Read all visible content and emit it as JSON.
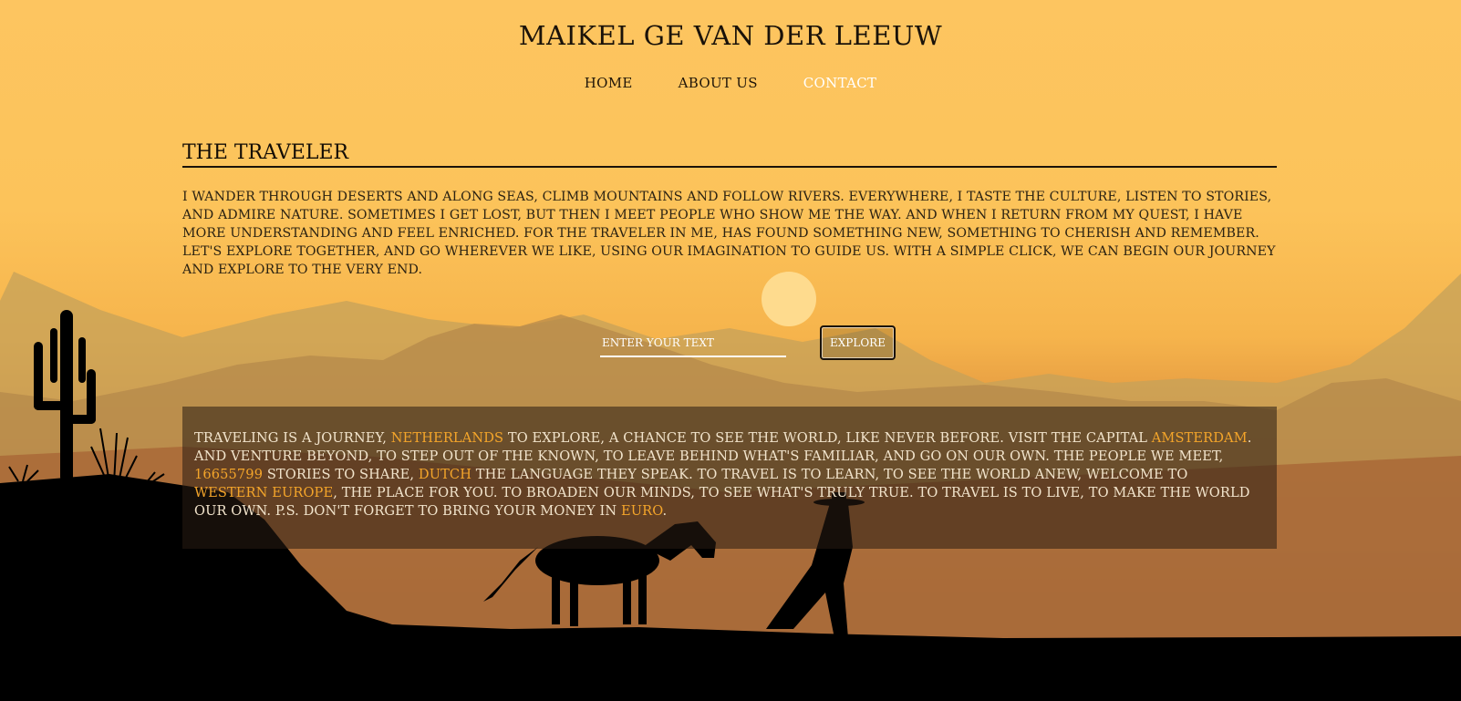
{
  "site": {
    "title": "MAIKEL GE VAN DER LEEUW"
  },
  "nav": {
    "items": [
      {
        "label": "HOME"
      },
      {
        "label": "ABOUT US"
      },
      {
        "label": "CONTACT"
      }
    ]
  },
  "main": {
    "heading": "THE TRAVELER",
    "intro": "I WANDER THROUGH DESERTS AND ALONG SEAS, CLIMB MOUNTAINS AND FOLLOW RIVERS. EVERYWHERE, I TASTE THE CULTURE, LISTEN TO STORIES, AND ADMIRE NATURE. SOMETIMES I GET LOST, BUT THEN I MEET PEOPLE WHO SHOW ME THE WAY. AND WHEN I RETURN FROM MY QUEST, I HAVE MORE UNDERSTANDING AND FEEL ENRICHED. FOR THE TRAVELER IN ME, HAS FOUND SOMETHING NEW, SOMETHING TO CHERISH AND REMEMBER. LET'S EXPLORE TOGETHER, AND GO WHEREVER WE LIKE, USING OUR IMAGINATION TO GUIDE US. WITH A SIMPLE CLICK, WE CAN BEGIN OUR JOURNEY AND EXPLORE TO THE VERY END."
  },
  "search": {
    "placeholder": "ENTER YOUR TEXT",
    "value": "",
    "button_label": "EXPLORE"
  },
  "result": {
    "t1": "TRAVELING IS A JOURNEY, ",
    "country": "NETHERLANDS",
    "t2": " TO EXPLORE, A CHANCE TO SEE THE WORLD, LIKE NEVER BEFORE. VISIT THE CAPITAL ",
    "capital": "AMSTERDAM",
    "t3": ". AND VENTURE BEYOND, TO STEP OUT OF THE KNOWN, TO LEAVE BEHIND WHAT'S FAMILIAR, AND GO ON OUR OWN. THE PEOPLE WE MEET, ",
    "population": "16655799",
    "t4": " STORIES TO SHARE, ",
    "language": "DUTCH",
    "t5": " THE LANGUAGE THEY SPEAK. TO TRAVEL IS TO LEARN, TO SEE THE WORLD ANEW, WELCOME TO ",
    "region": "WESTERN EUROPE",
    "t6": ", THE PLACE FOR YOU. TO BROADEN OUR MINDS, TO SEE WHAT'S TRULY TRUE. TO TRAVEL IS TO LIVE, TO MAKE THE WORLD OUR OWN. P.S. DON'T FORGET TO BRING YOUR MONEY IN ",
    "currency": "EURO",
    "t7": "."
  },
  "colors": {
    "highlight": "#f4a52a",
    "sky_top": "#fdc560",
    "ground": "#000000"
  }
}
